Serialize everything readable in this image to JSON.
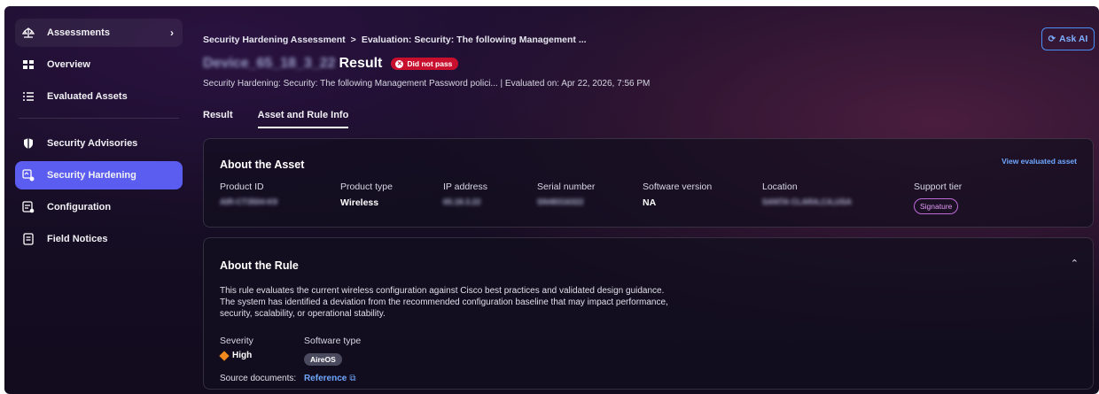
{
  "sidebar": {
    "items": [
      {
        "label": "Assessments",
        "icon": "scale-icon",
        "chevron": "›"
      },
      {
        "label": "Overview",
        "icon": "grid-icon"
      },
      {
        "label": "Evaluated Assets",
        "icon": "list-icon"
      },
      {
        "label": "Security Advisories",
        "icon": "shield-icon"
      },
      {
        "label": "Security Hardening",
        "icon": "hardening-icon"
      },
      {
        "label": "Configuration",
        "icon": "config-icon"
      },
      {
        "label": "Field Notices",
        "icon": "notice-icon"
      }
    ],
    "active_color": "#5b5cf0"
  },
  "header": {
    "breadcrumb": [
      "Security Hardening Assessment",
      "Evaluation: Security: The following Management ..."
    ],
    "breadcrumb_sep": ">",
    "ask_ai_label": "Ask AI",
    "device_name": "Device_65_18_3_22",
    "result_word": "Result",
    "status": "Did not pass",
    "status_color": "#c8102e",
    "subtitle": "Security Hardening: Security: The following Management Password polici... | Evaluated on: Apr 22, 2026, 7:56 PM"
  },
  "tabs": [
    {
      "label": "Result",
      "active": false
    },
    {
      "label": "Asset and Rule Info",
      "active": true
    }
  ],
  "asset": {
    "title": "About the Asset",
    "view_link": "View evaluated asset",
    "fields": [
      {
        "label": "Product ID",
        "value": "AIR-CT3504-K9",
        "blurred": true
      },
      {
        "label": "Product type",
        "value": "Wireless",
        "blurred": false
      },
      {
        "label": "IP address",
        "value": "65.18.3.22",
        "blurred": true
      },
      {
        "label": "Serial number",
        "value": "SN48316322",
        "blurred": true
      },
      {
        "label": "Software version",
        "value": "NA",
        "blurred": false
      },
      {
        "label": "Location",
        "value": "SANTA CLARA,CA,USA",
        "blurred": true
      },
      {
        "label": "Support tier",
        "value": "Signature",
        "blurred": false
      }
    ]
  },
  "rule": {
    "title": "About the Rule",
    "description": "This rule evaluates the current wireless configuration against Cisco best practices and validated design guidance. The system has identified a deviation from the recommended configuration baseline that may impact performance, security, scalability, or operational stability.",
    "severity_label": "Severity",
    "severity_value": "High",
    "severity_color": "#f08a1c",
    "software_type_label": "Software type",
    "software_type_value": "AireOS",
    "source_label": "Source documents:",
    "source_link": "Reference",
    "collapse_icon": "chevron-up-icon"
  }
}
